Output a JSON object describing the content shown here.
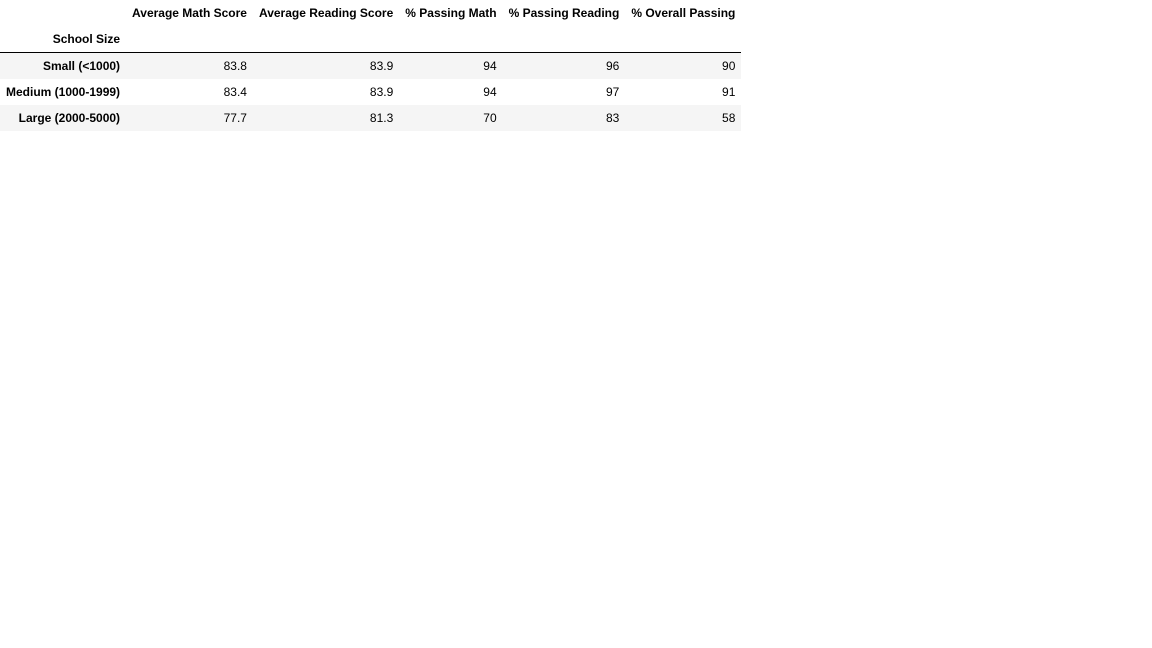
{
  "table": {
    "index_name": "School Size",
    "columns": [
      "Average Math Score",
      "Average Reading Score",
      "% Passing Math",
      "% Passing Reading",
      "% Overall Passing"
    ],
    "rows": [
      {
        "label": "Small (<1000)",
        "values": [
          "83.8",
          "83.9",
          "94",
          "96",
          "90"
        ]
      },
      {
        "label": "Medium (1000-1999)",
        "values": [
          "83.4",
          "83.9",
          "94",
          "97",
          "91"
        ]
      },
      {
        "label": "Large (2000-5000)",
        "values": [
          "77.7",
          "81.3",
          "70",
          "83",
          "58"
        ]
      }
    ]
  }
}
